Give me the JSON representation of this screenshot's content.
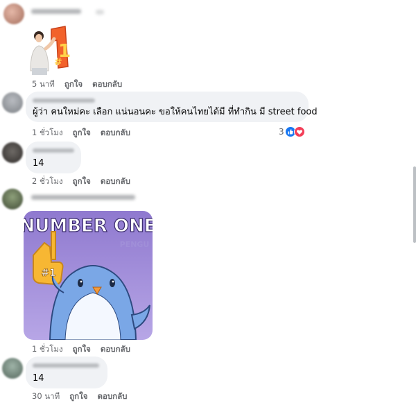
{
  "comments": [
    {
      "actions": {
        "time": "5 นาที",
        "like": "ถูกใจ",
        "reply": "ตอบกลับ"
      }
    },
    {
      "text": "ผู้ว่า คนใหม่คะ เลือก แน่นอนคะ ขอให้คนไทยได้มี ที่ทำกิน มี street food",
      "reaction_count": "3",
      "reaction_icons": [
        "like-icon",
        "heart-icon"
      ],
      "actions": {
        "time": "1 ชั่วโมง",
        "like": "ถูกใจ",
        "reply": "ตอบกลับ"
      }
    },
    {
      "text": "14",
      "actions": {
        "time": "2 ชั่วโมง",
        "like": "ถูกใจ",
        "reply": "ตอบกลับ"
      }
    },
    {
      "sticker": {
        "headline": "NUMBER ONE",
        "watermark": "PENGU",
        "badge": "#1"
      },
      "actions": {
        "time": "1 ชั่วโมง",
        "like": "ถูกใจ",
        "reply": "ตอบกลับ"
      }
    },
    {
      "text": "14",
      "actions": {
        "time": "30 นาที",
        "like": "ถูกใจ",
        "reply": "ตอบกลับ"
      }
    }
  ],
  "colors": {
    "bubble": "#f0f2f5",
    "action_text": "#65676b",
    "like_blue": "#1877f2",
    "love_red": "#f33e58",
    "sticker_bg": "#9b86d6"
  }
}
